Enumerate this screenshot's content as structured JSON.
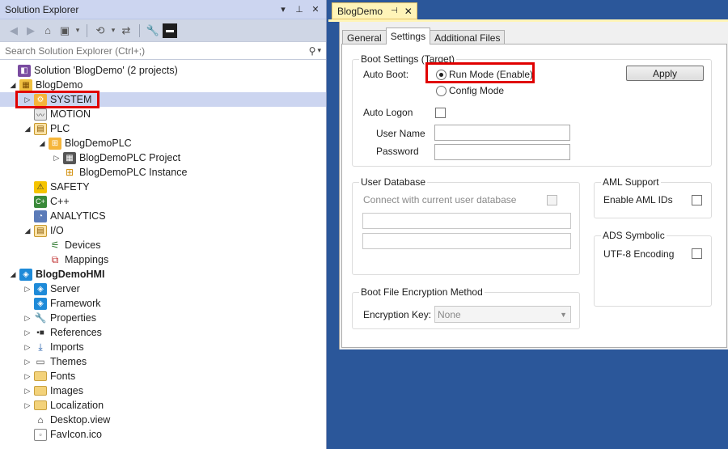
{
  "solution_explorer": {
    "title": "Solution Explorer",
    "search_placeholder": "Search Solution Explorer (Ctrl+;)",
    "tree": [
      {
        "label": "Solution 'BlogDemo' (2 projects)",
        "icon": "solution-icon"
      },
      {
        "label": "BlogDemo",
        "icon": "twincat-project-icon"
      },
      {
        "label": "SYSTEM",
        "icon": "system-icon"
      },
      {
        "label": "MOTION",
        "icon": "motion-icon"
      },
      {
        "label": "PLC",
        "icon": "plc-icon"
      },
      {
        "label": "BlogDemoPLC",
        "icon": "plc-project-icon"
      },
      {
        "label": "BlogDemoPLC Project",
        "icon": "plc-project-file-icon"
      },
      {
        "label": "BlogDemoPLC Instance",
        "icon": "plc-instance-icon"
      },
      {
        "label": "SAFETY",
        "icon": "safety-icon"
      },
      {
        "label": "C++",
        "icon": "cpp-icon"
      },
      {
        "label": "ANALYTICS",
        "icon": "analytics-icon"
      },
      {
        "label": "I/O",
        "icon": "io-icon"
      },
      {
        "label": "Devices",
        "icon": "devices-icon"
      },
      {
        "label": "Mappings",
        "icon": "mappings-icon"
      },
      {
        "label": "BlogDemoHMI",
        "icon": "hmi-project-icon"
      },
      {
        "label": "Server",
        "icon": "server-icon"
      },
      {
        "label": "Framework",
        "icon": "framework-icon"
      },
      {
        "label": "Properties",
        "icon": "wrench-icon"
      },
      {
        "label": "References",
        "icon": "references-icon"
      },
      {
        "label": "Imports",
        "icon": "imports-icon"
      },
      {
        "label": "Themes",
        "icon": "themes-icon"
      },
      {
        "label": "Fonts",
        "icon": "folder-icon"
      },
      {
        "label": "Images",
        "icon": "folder-icon"
      },
      {
        "label": "Localization",
        "icon": "folder-icon"
      },
      {
        "label": "Desktop.view",
        "icon": "view-file-icon"
      },
      {
        "label": "FavIcon.ico",
        "icon": "ico-file-icon"
      }
    ]
  },
  "editor": {
    "doc_tab": "BlogDemo",
    "tabs": [
      "General",
      "Settings",
      "Additional Files"
    ],
    "active_tab": "Settings",
    "boot_settings": {
      "title": "Boot Settings (Target)",
      "auto_boot_label": "Auto Boot:",
      "run_mode": "Run Mode (Enable)",
      "config_mode": "Config Mode",
      "apply": "Apply",
      "auto_logon": "Auto Logon",
      "user_name": "User Name",
      "password": "Password"
    },
    "user_database": {
      "title": "User Database",
      "connect": "Connect with current user database"
    },
    "aml_support": {
      "title": "AML Support",
      "enable": "Enable AML IDs"
    },
    "ads_symbolic": {
      "title": "ADS Symbolic",
      "utf8": "UTF-8 Encoding"
    },
    "boot_encryption": {
      "title": "Boot File Encryption Method",
      "key_label": "Encryption Key:",
      "key_value": "None"
    }
  },
  "colors": {
    "highlight_red": "#e00000",
    "selection": "#ccd5f0",
    "editor_bg": "#2b579a",
    "doc_tab": "#fff4b8"
  }
}
